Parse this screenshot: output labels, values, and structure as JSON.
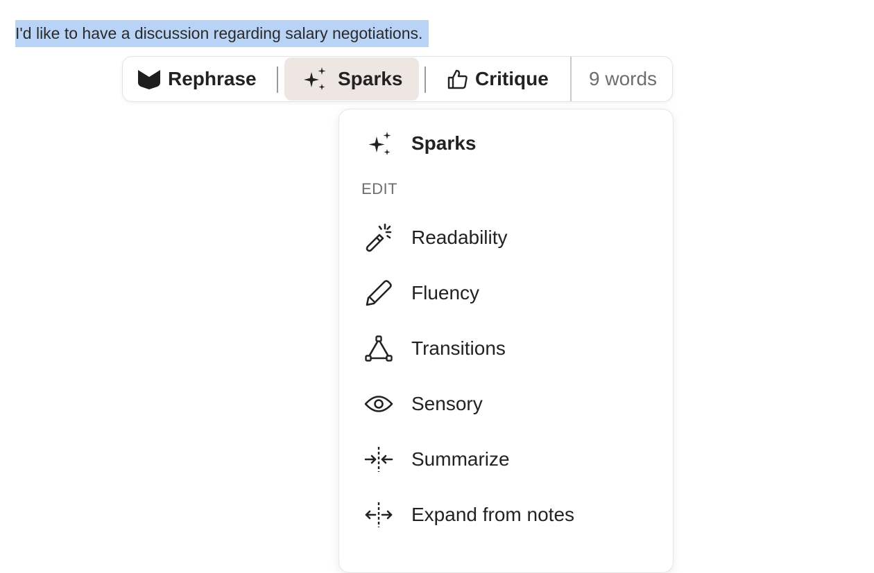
{
  "document": {
    "selected_text": "I'd like to have a discussion regarding salary negotiations."
  },
  "toolbar": {
    "rephrase_label": "Rephrase",
    "sparks_label": "Sparks",
    "critique_label": "Critique",
    "word_count": "9 words",
    "active_tab": "Sparks",
    "active_bg": "#eee6e3"
  },
  "menu": {
    "header_label": "Sparks",
    "section_label": "EDIT",
    "items": [
      {
        "label": "Readability",
        "icon": "magic-wand-icon"
      },
      {
        "label": "Fluency",
        "icon": "pencil-icon"
      },
      {
        "label": "Transitions",
        "icon": "triangle-nodes-icon"
      },
      {
        "label": "Sensory",
        "icon": "eye-icon"
      },
      {
        "label": "Summarize",
        "icon": "compress-arrows-icon"
      },
      {
        "label": "Expand from notes",
        "icon": "expand-arrows-icon"
      }
    ]
  },
  "colors": {
    "selection": "#b8d3f5",
    "text": "#222222",
    "muted": "#6a6f6a"
  }
}
